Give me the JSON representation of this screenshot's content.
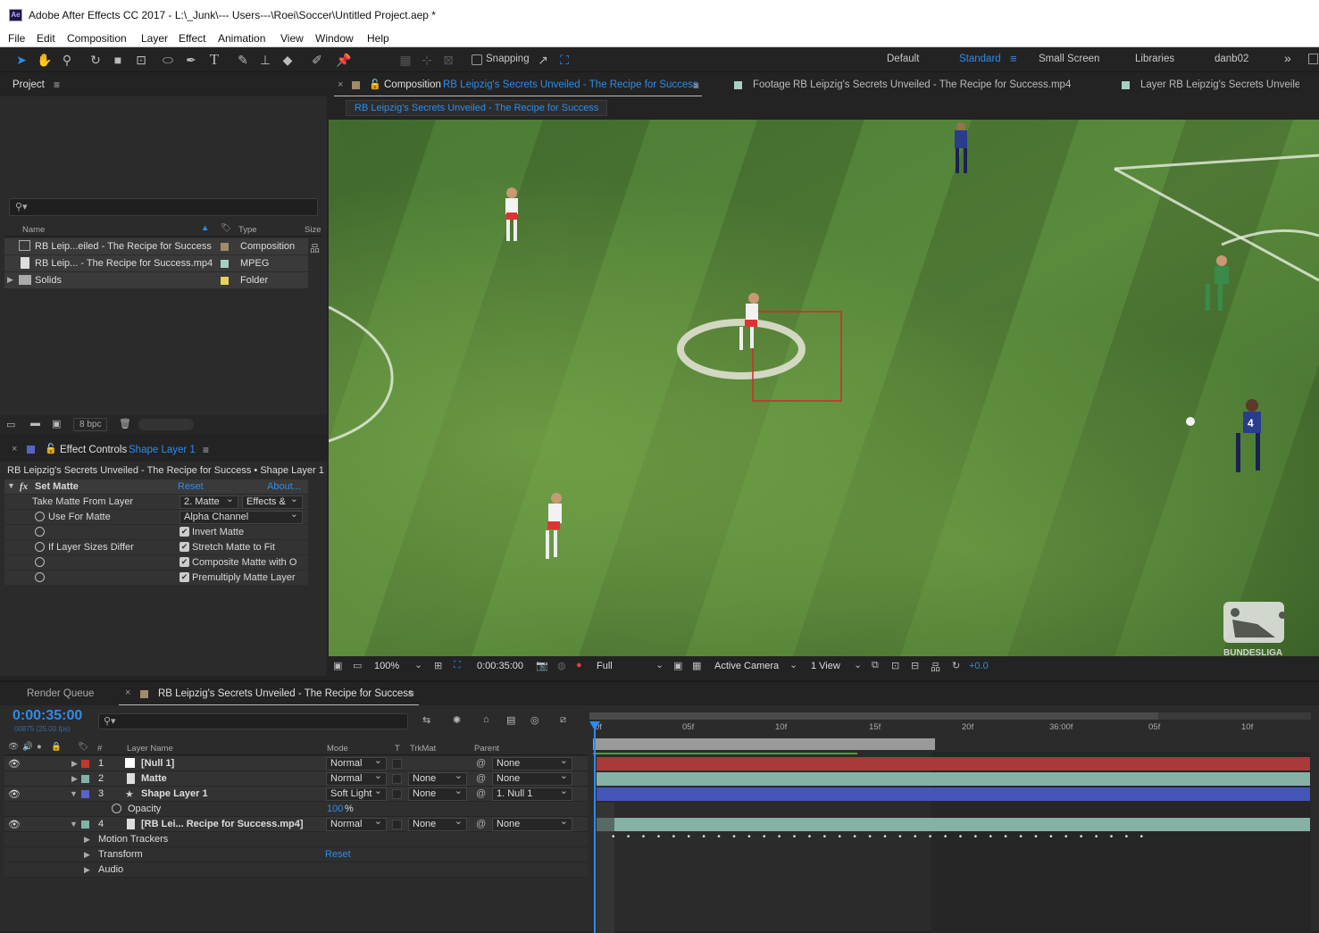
{
  "title_bar": {
    "app_icon": "Ae",
    "title": "Adobe After Effects CC 2017 - L:\\_Junk\\--- Users---\\Roei\\Soccer\\Untitled Project.aep *"
  },
  "menu": [
    "File",
    "Edit",
    "Composition",
    "Layer",
    "Effect",
    "Animation",
    "View",
    "Window",
    "Help"
  ],
  "toolbar": {
    "snapping_label": "Snapping",
    "workspaces": [
      "Default",
      "Standard",
      "Small Screen",
      "Libraries",
      "danb02"
    ],
    "active_workspace": "Standard",
    "more_glyph": "»"
  },
  "project_panel": {
    "title": "Project",
    "columns": {
      "name": "Name",
      "type": "Type",
      "size": "Size"
    },
    "items": [
      {
        "name": "RB Leip...eiled - The Recipe for Success",
        "type": "Composition",
        "label_color": "#a08c6a",
        "icon": "composition-icon"
      },
      {
        "name": "RB Leip... - The Recipe for Success.mp4",
        "type": "MPEG",
        "label_color": "#a8d0c0",
        "icon": "footage-icon"
      },
      {
        "name": "Solids",
        "type": "Folder",
        "label_color": "#e6d35a",
        "icon": "folder-icon"
      }
    ],
    "bpc": "8 bpc"
  },
  "effect_controls": {
    "title_prefix": "Effect Controls",
    "title_layer": "Shape Layer 1",
    "breadcrumb": "RB Leipzig's Secrets Unveiled - The Recipe for Success • Shape Layer 1",
    "effect_name": "Set Matte",
    "reset": "Reset",
    "about": "About...",
    "rows": {
      "take_matte_label": "Take Matte From Layer",
      "take_matte_value": "2. Matte",
      "take_matte_source": "Effects &",
      "use_for_matte_label": "Use For Matte",
      "use_for_matte_value": "Alpha Channel",
      "invert_matte": "Invert Matte",
      "if_layer_sizes_differ_label": "If Layer Sizes Differ",
      "stretch_matte": "Stretch Matte to Fit",
      "composite_matte": "Composite Matte with O",
      "premultiply": "Premultiply Matte Layer"
    }
  },
  "composition_viewer": {
    "tabs": [
      {
        "prefix": "Composition",
        "name": "RB Leipzig's Secrets Unveiled - The Recipe for Success",
        "color": "#a08c6a"
      },
      {
        "prefix": "Footage",
        "name": "RB Leipzig's Secrets Unveiled - The Recipe for Success.mp4",
        "color": "#a8d0c0"
      },
      {
        "prefix": "Layer",
        "name": "RB Leipzig's Secrets Unveilec",
        "color": "#a8d0c0"
      }
    ],
    "breadcrumb": "RB Leipzig's Secrets Unveiled - The Recipe for Success",
    "watermark": "BUNDESLIGA",
    "player_number": "4",
    "footer": {
      "zoom": "100%",
      "timecode": "0:00:35:00",
      "resolution": "Full",
      "camera": "Active Camera",
      "views": "1 View",
      "exposure": "+0.0"
    }
  },
  "timeline": {
    "render_queue_tab": "Render Queue",
    "comp_tab": "RB Leipzig's Secrets Unveiled - The Recipe for Success",
    "timecode": "0:00:35:00",
    "fps": "00875 (25.00 fps)",
    "columns": {
      "layer_name": "Layer Name",
      "mode": "Mode",
      "t": "T",
      "trkmat": "TrkMat",
      "parent": "Parent",
      "number": "#"
    },
    "ruler": [
      "0f",
      "05f",
      "10f",
      "15f",
      "20f",
      "36:00f",
      "05f",
      "10f"
    ],
    "layers": [
      {
        "num": "1",
        "name": "[Null 1]",
        "mode": "Normal",
        "trkmat": "",
        "parent": "None",
        "color": "#c0392b",
        "bar_color": "#a83a3a"
      },
      {
        "num": "2",
        "name": "Matte",
        "mode": "Normal",
        "trkmat": "None",
        "parent": "None",
        "color": "#7fb3a7",
        "bar_color": "#86b1a6"
      },
      {
        "num": "3",
        "name": "Shape Layer 1",
        "mode": "Soft Light",
        "trkmat": "None",
        "parent": "1. Null 1",
        "color": "#5a62c8",
        "bar_color": "#4456b8"
      },
      {
        "num": "4",
        "name": "[RB Lei... Recipe for Success.mp4]",
        "mode": "Normal",
        "trkmat": "None",
        "parent": "None",
        "color": "#7fb3a7",
        "bar_color": "#86b1a6"
      }
    ],
    "opacity_label": "Opacity",
    "opacity_value": "100",
    "opacity_unit": "%",
    "sub_rows": {
      "motion_trackers": "Motion Trackers",
      "transform": "Transform",
      "transform_reset": "Reset",
      "audio": "Audio"
    }
  }
}
